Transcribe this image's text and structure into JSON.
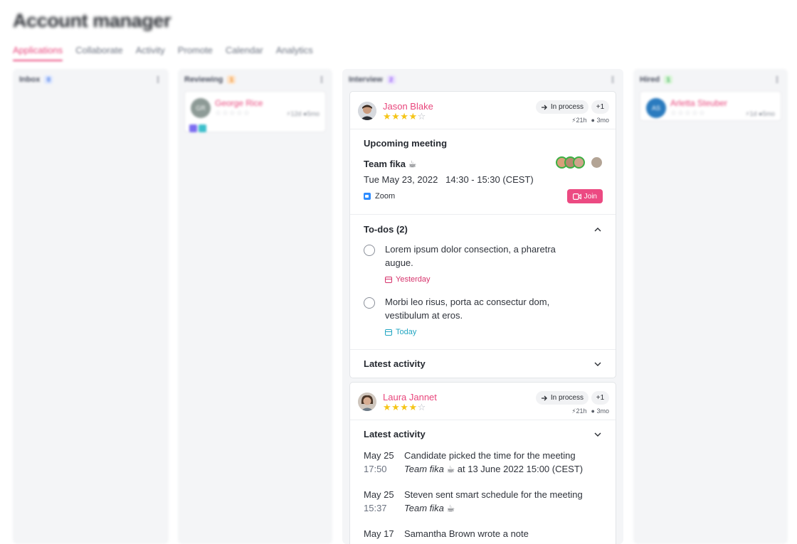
{
  "page": {
    "title": "Account manager"
  },
  "tabs": [
    "Applications",
    "Collaborate",
    "Activity",
    "Promote",
    "Calendar",
    "Analytics"
  ],
  "columns": {
    "inbox": {
      "name": "Inbox",
      "count": "0"
    },
    "reviewing": {
      "name": "Reviewing",
      "count": "1"
    },
    "interview": {
      "name": "Interview",
      "count": "2"
    },
    "hired": {
      "name": "Hired",
      "count": "1"
    }
  },
  "reviewing_card": {
    "initials": "GR",
    "name": "George Rice",
    "stars": "☆☆☆☆☆",
    "meta": "⚡12d ●5mo"
  },
  "hired_card": {
    "initials": "AS",
    "name": "Arletta Steuber",
    "stars": "☆☆☆☆☆",
    "meta": "⚡1d ●5mo"
  },
  "jason": {
    "name": "Jason Blake",
    "stars_on": "★★★★",
    "stars_off": "☆",
    "rating": 4,
    "status": "In process",
    "extra": "+1",
    "age": "21h",
    "tenure": "3mo",
    "meeting": {
      "heading": "Upcoming meeting",
      "name": "Team fika ☕",
      "date": "Tue May 23, 2022   14:30 - 15:30 (CEST)",
      "app": "Zoom",
      "join": "Join"
    },
    "todos": {
      "heading": "To-dos (2)",
      "items": [
        {
          "text": "Lorem ipsum dolor consection, a pharetra augue.",
          "due": "Yesterday",
          "due_color": "#d6336c"
        },
        {
          "text": "Morbi leo risus, porta ac consectur dom, vestibulum at eros.",
          "due": "Today",
          "due_color": "#22a6c2"
        }
      ]
    },
    "activity_heading": "Latest activity"
  },
  "laura": {
    "name": "Laura Jannet",
    "stars_on": "★★★★",
    "stars_off": "☆",
    "rating": 4,
    "status": "In process",
    "extra": "+1",
    "age": "21h",
    "tenure": "3mo",
    "activity_heading": "Latest activity",
    "activity": [
      {
        "date": "May 25",
        "time": "17:50",
        "text": "Candidate picked the time for the meeting",
        "sub_em": "Team fika ☕",
        "sub_rest": " at 13 June 2022 15:00 (CEST)"
      },
      {
        "date": "May 25",
        "time": "15:37",
        "text": "Steven sent smart schedule for the meeting",
        "sub_em": "Team fika ☕",
        "sub_rest": ""
      },
      {
        "date": "May 17",
        "time": "",
        "text": "Samantha Brown wrote a note",
        "sub_em": "",
        "sub_rest": ""
      }
    ]
  },
  "colors": {
    "accent": "#e8467c",
    "join": "#ec4a82",
    "star": "#f5c518",
    "zoom": "#2d8cff"
  }
}
